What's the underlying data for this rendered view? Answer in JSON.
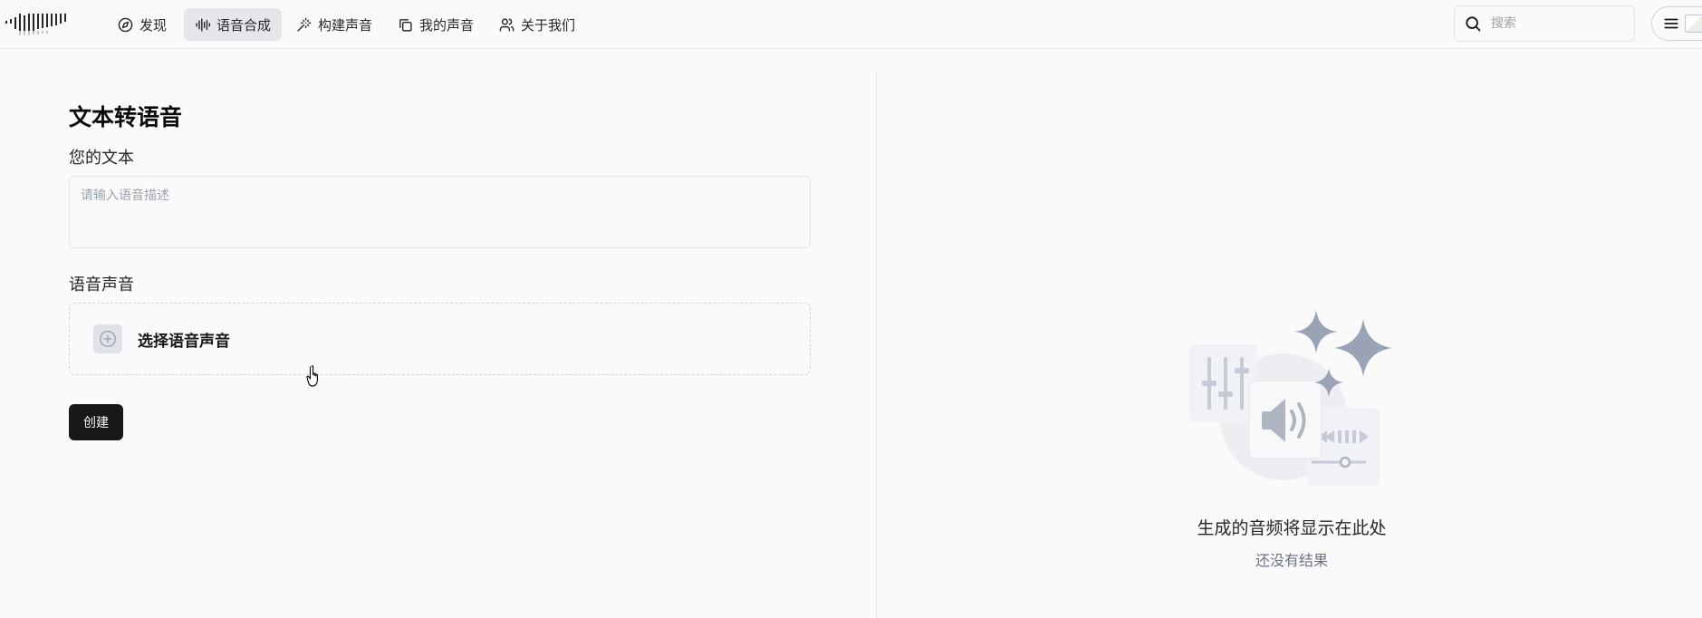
{
  "nav": {
    "items": [
      {
        "label": "发现",
        "icon": "compass-icon",
        "active": false
      },
      {
        "label": "语音合成",
        "icon": "audio-waveform-icon",
        "active": true
      },
      {
        "label": "构建声音",
        "icon": "magic-wand-icon",
        "active": false
      },
      {
        "label": "我的声音",
        "icon": "stacked-copies-icon",
        "active": false
      },
      {
        "label": "关于我们",
        "icon": "users-icon",
        "active": false
      }
    ]
  },
  "search": {
    "placeholder": "搜索"
  },
  "form": {
    "title": "文本转语音",
    "text_label": "您的文本",
    "text_placeholder": "请输入语音描述",
    "text_value": "",
    "voice_label": "语音声音",
    "voice_picker_label": "选择语音声音",
    "create_button": "创建"
  },
  "result": {
    "empty_title": "生成的音频将显示在此处",
    "empty_subtitle": "还没有结果"
  },
  "colors": {
    "accent_dark": "#18181b",
    "nav_active_bg": "#e4e6ea",
    "illustration_gray": "#9aa3b5"
  }
}
